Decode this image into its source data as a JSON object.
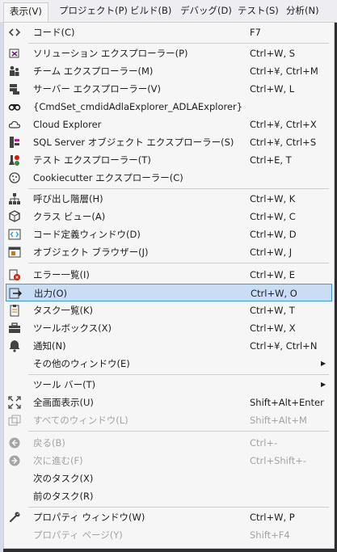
{
  "menubar": {
    "items": [
      "表示(V)",
      "プロジェクト(P)",
      "ビルド(B)",
      "デバッグ(D)",
      "テスト(S)",
      "分析(N)"
    ]
  },
  "menu": {
    "items": [
      {
        "icon": "code-brackets-icon",
        "label": "コード(C)",
        "shortcut": "F7"
      },
      {
        "icon": "solution-explorer-icon",
        "label": "ソリューション エクスプローラー(P)",
        "shortcut": "Ctrl+W, S"
      },
      {
        "icon": "team-explorer-icon",
        "label": "チーム エクスプローラー(M)",
        "shortcut": "Ctrl+¥, Ctrl+M"
      },
      {
        "icon": "server-explorer-icon",
        "label": "サーバー エクスプローラー(V)",
        "shortcut": "Ctrl+W, L"
      },
      {
        "icon": "adla-explorer-icon",
        "label": "{CmdSet_cmdidAdlaExplorer_ADLAExplorer}",
        "shortcut": ""
      },
      {
        "icon": "cloud-icon",
        "label": "Cloud Explorer",
        "shortcut": "Ctrl+¥, Ctrl+X"
      },
      {
        "icon": "sql-server-icon",
        "label": "SQL Server オブジェクト エクスプローラー(S)",
        "shortcut": "Ctrl+¥, Ctrl+S"
      },
      {
        "icon": "test-explorer-icon",
        "label": "テスト エクスプローラー(T)",
        "shortcut": "Ctrl+E, T"
      },
      {
        "icon": "cookiecutter-icon",
        "label": "Cookiecutter エクスプローラー(C)",
        "shortcut": ""
      },
      {
        "icon": "call-hierarchy-icon",
        "label": "呼び出し階層(H)",
        "shortcut": "Ctrl+W, K"
      },
      {
        "icon": "class-view-icon",
        "label": "クラス ビュー(A)",
        "shortcut": "Ctrl+W, C"
      },
      {
        "icon": "code-definition-icon",
        "label": "コード定義ウィンドウ(D)",
        "shortcut": "Ctrl+W, D"
      },
      {
        "icon": "object-browser-icon",
        "label": "オブジェクト ブラウザー(J)",
        "shortcut": "Ctrl+W, J"
      },
      {
        "icon": "error-list-icon",
        "label": "エラー一覧(I)",
        "shortcut": "Ctrl+W, E"
      },
      {
        "icon": "output-icon",
        "label": "出力(O)",
        "shortcut": "Ctrl+W, O"
      },
      {
        "icon": "task-list-icon",
        "label": "タスク一覧(K)",
        "shortcut": "Ctrl+W, T"
      },
      {
        "icon": "toolbox-icon",
        "label": "ツールボックス(X)",
        "shortcut": "Ctrl+W, X"
      },
      {
        "icon": "bell-icon",
        "label": "通知(N)",
        "shortcut": "Ctrl+¥, Ctrl+N"
      },
      {
        "icon": "",
        "label": "その他のウィンドウ(E)",
        "shortcut": ""
      },
      {
        "icon": "",
        "label": "ツール バー(T)",
        "shortcut": ""
      },
      {
        "icon": "full-screen-icon",
        "label": "全画面表示(U)",
        "shortcut": "Shift+Alt+Enter"
      },
      {
        "icon": "all-windows-icon",
        "label": "すべてのウィンドウ(L)",
        "shortcut": "Shift+Alt+M"
      },
      {
        "icon": "back-arrow-icon",
        "label": "戻る(B)",
        "shortcut": "Ctrl+-"
      },
      {
        "icon": "forward-arrow-icon",
        "label": "次に進む(F)",
        "shortcut": "Ctrl+Shift+-"
      },
      {
        "icon": "",
        "label": "次のタスク(X)",
        "shortcut": ""
      },
      {
        "icon": "",
        "label": "前のタスク(R)",
        "shortcut": ""
      },
      {
        "icon": "wrench-icon",
        "label": "プロパティ ウィンドウ(W)",
        "shortcut": "Ctrl+W, P"
      },
      {
        "icon": "",
        "label": "プロパティ ページ(Y)",
        "shortcut": "Shift+F4"
      }
    ]
  }
}
